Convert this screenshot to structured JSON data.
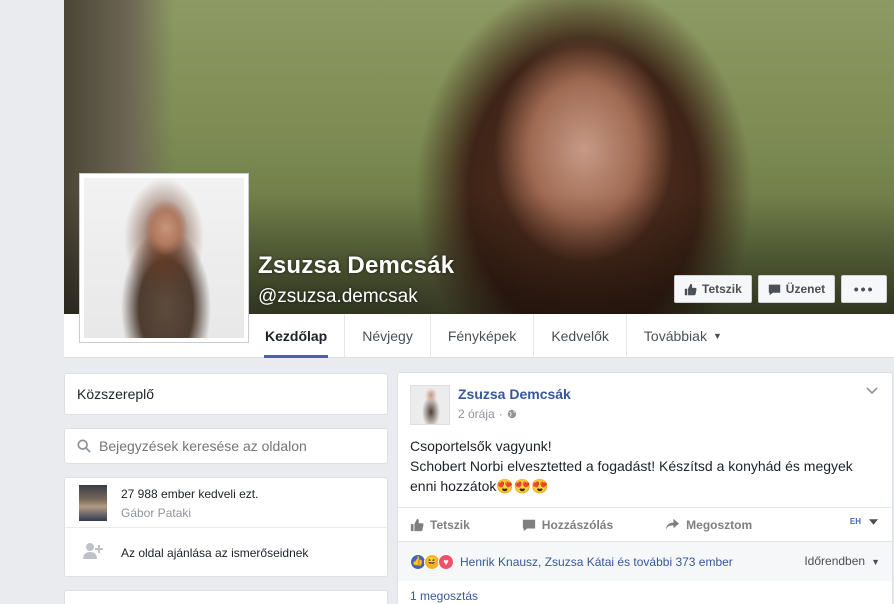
{
  "page": {
    "name": "Zsuzsa Demcsák",
    "username": "@zsuzsa.demcsak"
  },
  "cover_actions": {
    "like_label": "Tetszik",
    "message_label": "Üzenet",
    "more_label": "•••"
  },
  "nav": {
    "items": [
      {
        "label": "Kezdőlap",
        "active": true
      },
      {
        "label": "Névjegy"
      },
      {
        "label": "Fényképek"
      },
      {
        "label": "Kedvelők"
      },
      {
        "label": "Továbbiak"
      }
    ]
  },
  "sidebar": {
    "category": "Közszereplő",
    "search_placeholder": "Bejegyzések keresése az oldalon",
    "likes_count_text": "27 988 ember kedveli ezt.",
    "likes_friend": "Gábor Pataki",
    "invite_text": "Az oldal ajánlása az ismerőseidnek"
  },
  "post": {
    "author": "Zsuzsa Demcsák",
    "time": "2 órája",
    "body_line1": "Csoportelsők vagyunk!",
    "body_line2": "Schobert Norbi elvesztetted a fogadást! Készítsd a konyhád és megyek",
    "body_line3": "enni hozzátok😍😍😍",
    "like_label": "Tetszik",
    "comment_label": "Hozzászólás",
    "share_label": "Megosztom",
    "reactions_text": "Henrik Knausz, Zsuzsa Kátai és további 373 ember",
    "sort_label": "Időrendben",
    "shares_text": "1 megosztás"
  },
  "colors": {
    "link": "#365899",
    "accent": "#4267b2",
    "love": "#f25268",
    "haha": "#f7b125"
  }
}
